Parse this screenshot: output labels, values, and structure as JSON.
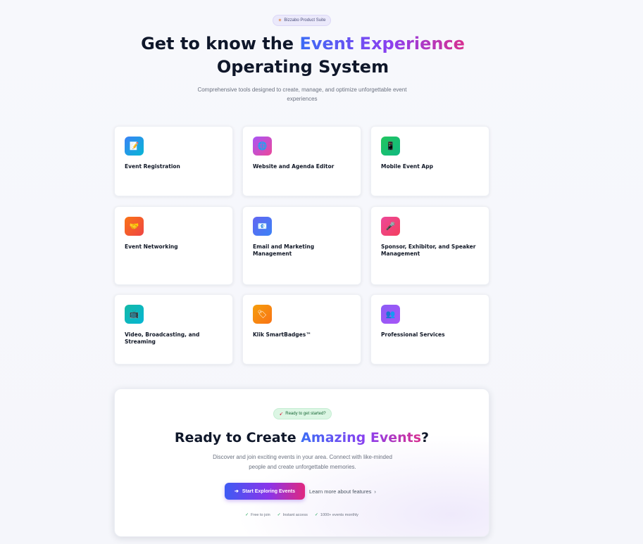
{
  "hero": {
    "badge": {
      "icon": "sparkle-icon",
      "label": "Bizzabo Product Suite"
    },
    "title_part1": "Get to know the ",
    "title_highlight": "Event Experience",
    "title_part2": "Operating System",
    "subtitle": "Comprehensive tools designed to create, manage, and optimize unforgettable event experiences"
  },
  "features": [
    {
      "title": "Event Registration",
      "icon": "clipboard-icon",
      "glyph": "📝",
      "color_from": "#3b82f6",
      "color_to": "#06b6d4"
    },
    {
      "title": "Website and Agenda Editor",
      "icon": "globe-icon",
      "glyph": "🌐",
      "color_from": "#a855f7",
      "color_to": "#ec4899"
    },
    {
      "title": "Mobile Event App",
      "icon": "mobile-phone-icon",
      "glyph": "📱",
      "color_from": "#22c55e",
      "color_to": "#10b981"
    },
    {
      "title": "Event Networking",
      "icon": "handshake-icon",
      "glyph": "🤝",
      "color_from": "#f97316",
      "color_to": "#ef4444"
    },
    {
      "title": "Email and Marketing Management",
      "icon": "email-icon",
      "glyph": "📧",
      "color_from": "#6366f1",
      "color_to": "#3b82f6"
    },
    {
      "title": "Sponsor, Exhibitor, and Speaker Management",
      "icon": "microphone-icon",
      "glyph": "🎤",
      "color_from": "#ec4899",
      "color_to": "#f43f5e"
    },
    {
      "title": "Video, Broadcasting, and Streaming",
      "icon": "tv-icon",
      "glyph": "📺",
      "color_from": "#14b8a6",
      "color_to": "#06b6d4"
    },
    {
      "title": "Klik SmartBadges™",
      "icon": "badge-tag-icon",
      "glyph": "🏷",
      "color_from": "#f59e0b",
      "color_to": "#f97316"
    },
    {
      "title": "Professional Services",
      "icon": "people-icon",
      "glyph": "👥",
      "color_from": "#8b5cf6",
      "color_to": "#a855f7"
    }
  ],
  "cta": {
    "badge": {
      "icon": "rocket-icon",
      "label": "Ready to get started?"
    },
    "title_part1": "Ready to Create ",
    "title_highlight": "Amazing Events",
    "title_part2": "?",
    "subtitle": "Discover and join exciting events in your area. Connect with like-minded people and create unforgettable memories.",
    "primary_button": {
      "icon": "arrow-right-icon",
      "label": "Start Exploring Events"
    },
    "secondary_link": {
      "label": "Learn more about features",
      "icon": "chevron-right-icon"
    },
    "checks": [
      "Free to join",
      "Instant access",
      "1000+ events monthly"
    ]
  }
}
